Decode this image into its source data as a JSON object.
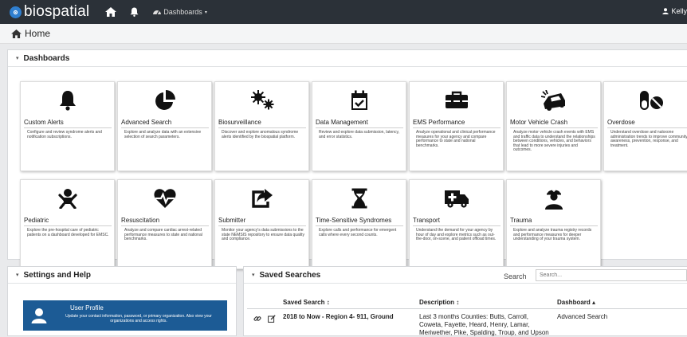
{
  "topbar": {
    "brand": "biospatial",
    "dashboards_label": "Dashboards",
    "user_name": "Kelly"
  },
  "home": {
    "title": "Home"
  },
  "dashboards_panel": {
    "title": "Dashboards",
    "cards": [
      {
        "title": "Custom Alerts",
        "icon": "bell-icon",
        "desc": "Configure and review syndrome alerts and notification subscriptions."
      },
      {
        "title": "Advanced Search",
        "icon": "pie-chart-icon",
        "desc": "Explore and analyze data with an extensive selection of search parameters."
      },
      {
        "title": "Biosurveillance",
        "icon": "virus-icon",
        "desc": "Discover and explore anomalous syndrome alerts identified by the biospatial platform."
      },
      {
        "title": "Data Management",
        "icon": "calendar-check-icon",
        "desc": "Review and explore data submission, latency, and error statistics."
      },
      {
        "title": "EMS Performance",
        "icon": "toolbox-icon",
        "desc": "Analyze operational and clinical performance measures for your agency and compare performance to state and national benchmarks."
      },
      {
        "title": "Motor Vehicle Crash",
        "icon": "car-crash-icon",
        "desc": "Analyze motor vehicle crash events with EMS and traffic data to understand the relationships between conditions, vehicles, and behaviors that lead to more severe injuries and outcomes."
      },
      {
        "title": "Overdose",
        "icon": "pills-icon",
        "desc": "Understand overdose and naloxone administration trends to improve community awareness, prevention, response, and treatment."
      },
      {
        "title": "Pediatric",
        "icon": "baby-icon",
        "desc": "Explore the pre-hospital care of pediatric patients on a dashboard developed for EMSC."
      },
      {
        "title": "Resuscitation",
        "icon": "heartbeat-icon",
        "desc": "Analyze and compare cardiac arrest-related performance measures to state and national benchmarks."
      },
      {
        "title": "Submitter",
        "icon": "share-square-icon",
        "desc": "Monitor your agency's data submissions to the state NEMSIS repository to ensure data quality and compliance."
      },
      {
        "title": "Time-Sensitive Syndromes",
        "icon": "hourglass-icon",
        "desc": "Explore calls and performance for emergent calls where every second counts."
      },
      {
        "title": "Transport",
        "icon": "ambulance-icon",
        "desc": "Understand the demand for your agency by hour of day and explore metrics such as out-the-door, on-scene, and patient offload times."
      },
      {
        "title": "Trauma",
        "icon": "injured-person-icon",
        "desc": "Explore and analyze trauma registry records and performance measures for deeper understanding of your trauma system."
      }
    ]
  },
  "settings_panel": {
    "title": "Settings and Help",
    "user_profile": {
      "title": "User Profile",
      "desc": "Update your contact information, password, or primary organization. Also view your organizations and access rights."
    }
  },
  "saved_panel": {
    "title": "Saved Searches",
    "search_label": "Search",
    "search_placeholder": "Search...",
    "columns": [
      "Saved Search ↕",
      "Description ↕",
      "Dashboard ▴"
    ],
    "rows": [
      {
        "name": "2018 to Now - Region 4- 911, Ground",
        "description": "Last 3 months Counties: Butts, Carroll, Coweta, Fayette, Heard, Henry, Lamar, Meriwether, Pike, Spalding, Troup, and Upson",
        "dashboard": "Advanced Search"
      }
    ]
  },
  "colors": {
    "topbar": "#2b3138",
    "accent_blue": "#1c5b95",
    "logo_blue": "#2f7fd0"
  }
}
